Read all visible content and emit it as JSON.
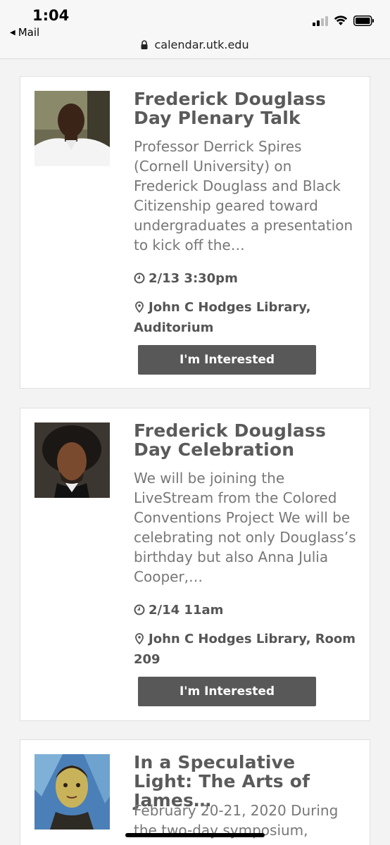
{
  "status": {
    "time": "1:04",
    "back_app": "Mail",
    "url": "calendar.utk.edu"
  },
  "events": [
    {
      "title": "Frederick Douglass Day Plenary Talk",
      "description": "Professor Derrick Spires (Cornell University) on Frederick Douglass and Black Citizenship geared toward undergraduates a presentation to kick off the…",
      "time": "2/13 3:30pm",
      "location": "John C Hodges Library, Auditorium",
      "button": "I'm Interested"
    },
    {
      "title": "Frederick Douglass Day Celebration",
      "description": "We will be joining the LiveStream from the Colored Conventions Project We will be celebrating not only Douglass’s birthday but also Anna Julia Cooper,…",
      "time": "2/14 11am",
      "location": "John C Hodges Library, Room 209",
      "button": "I'm Interested"
    },
    {
      "title": "In a Speculative Light: The Arts of James…",
      "description": "February 20-21, 2020 During the two-day symposium,"
    }
  ]
}
